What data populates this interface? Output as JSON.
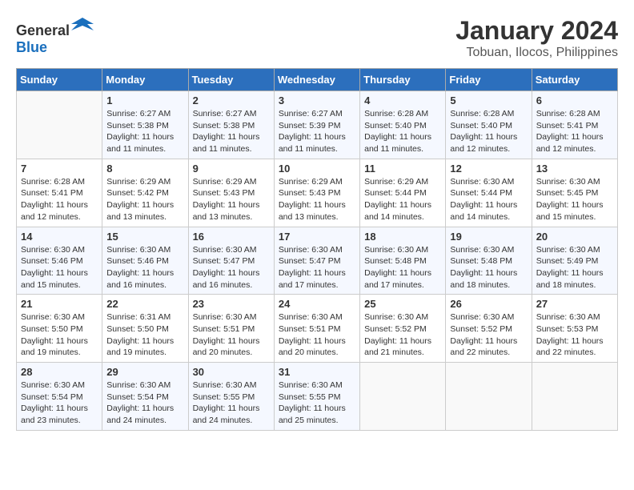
{
  "logo": {
    "general": "General",
    "blue": "Blue"
  },
  "title": "January 2024",
  "subtitle": "Tobuan, Ilocos, Philippines",
  "days_of_week": [
    "Sunday",
    "Monday",
    "Tuesday",
    "Wednesday",
    "Thursday",
    "Friday",
    "Saturday"
  ],
  "weeks": [
    [
      {
        "day": "",
        "sunrise": "",
        "sunset": "",
        "daylight": ""
      },
      {
        "day": "1",
        "sunrise": "Sunrise: 6:27 AM",
        "sunset": "Sunset: 5:38 PM",
        "daylight": "Daylight: 11 hours and 11 minutes."
      },
      {
        "day": "2",
        "sunrise": "Sunrise: 6:27 AM",
        "sunset": "Sunset: 5:38 PM",
        "daylight": "Daylight: 11 hours and 11 minutes."
      },
      {
        "day": "3",
        "sunrise": "Sunrise: 6:27 AM",
        "sunset": "Sunset: 5:39 PM",
        "daylight": "Daylight: 11 hours and 11 minutes."
      },
      {
        "day": "4",
        "sunrise": "Sunrise: 6:28 AM",
        "sunset": "Sunset: 5:40 PM",
        "daylight": "Daylight: 11 hours and 11 minutes."
      },
      {
        "day": "5",
        "sunrise": "Sunrise: 6:28 AM",
        "sunset": "Sunset: 5:40 PM",
        "daylight": "Daylight: 11 hours and 12 minutes."
      },
      {
        "day": "6",
        "sunrise": "Sunrise: 6:28 AM",
        "sunset": "Sunset: 5:41 PM",
        "daylight": "Daylight: 11 hours and 12 minutes."
      }
    ],
    [
      {
        "day": "7",
        "sunrise": "Sunrise: 6:28 AM",
        "sunset": "Sunset: 5:41 PM",
        "daylight": "Daylight: 11 hours and 12 minutes."
      },
      {
        "day": "8",
        "sunrise": "Sunrise: 6:29 AM",
        "sunset": "Sunset: 5:42 PM",
        "daylight": "Daylight: 11 hours and 13 minutes."
      },
      {
        "day": "9",
        "sunrise": "Sunrise: 6:29 AM",
        "sunset": "Sunset: 5:43 PM",
        "daylight": "Daylight: 11 hours and 13 minutes."
      },
      {
        "day": "10",
        "sunrise": "Sunrise: 6:29 AM",
        "sunset": "Sunset: 5:43 PM",
        "daylight": "Daylight: 11 hours and 13 minutes."
      },
      {
        "day": "11",
        "sunrise": "Sunrise: 6:29 AM",
        "sunset": "Sunset: 5:44 PM",
        "daylight": "Daylight: 11 hours and 14 minutes."
      },
      {
        "day": "12",
        "sunrise": "Sunrise: 6:30 AM",
        "sunset": "Sunset: 5:44 PM",
        "daylight": "Daylight: 11 hours and 14 minutes."
      },
      {
        "day": "13",
        "sunrise": "Sunrise: 6:30 AM",
        "sunset": "Sunset: 5:45 PM",
        "daylight": "Daylight: 11 hours and 15 minutes."
      }
    ],
    [
      {
        "day": "14",
        "sunrise": "Sunrise: 6:30 AM",
        "sunset": "Sunset: 5:46 PM",
        "daylight": "Daylight: 11 hours and 15 minutes."
      },
      {
        "day": "15",
        "sunrise": "Sunrise: 6:30 AM",
        "sunset": "Sunset: 5:46 PM",
        "daylight": "Daylight: 11 hours and 16 minutes."
      },
      {
        "day": "16",
        "sunrise": "Sunrise: 6:30 AM",
        "sunset": "Sunset: 5:47 PM",
        "daylight": "Daylight: 11 hours and 16 minutes."
      },
      {
        "day": "17",
        "sunrise": "Sunrise: 6:30 AM",
        "sunset": "Sunset: 5:47 PM",
        "daylight": "Daylight: 11 hours and 17 minutes."
      },
      {
        "day": "18",
        "sunrise": "Sunrise: 6:30 AM",
        "sunset": "Sunset: 5:48 PM",
        "daylight": "Daylight: 11 hours and 17 minutes."
      },
      {
        "day": "19",
        "sunrise": "Sunrise: 6:30 AM",
        "sunset": "Sunset: 5:48 PM",
        "daylight": "Daylight: 11 hours and 18 minutes."
      },
      {
        "day": "20",
        "sunrise": "Sunrise: 6:30 AM",
        "sunset": "Sunset: 5:49 PM",
        "daylight": "Daylight: 11 hours and 18 minutes."
      }
    ],
    [
      {
        "day": "21",
        "sunrise": "Sunrise: 6:30 AM",
        "sunset": "Sunset: 5:50 PM",
        "daylight": "Daylight: 11 hours and 19 minutes."
      },
      {
        "day": "22",
        "sunrise": "Sunrise: 6:31 AM",
        "sunset": "Sunset: 5:50 PM",
        "daylight": "Daylight: 11 hours and 19 minutes."
      },
      {
        "day": "23",
        "sunrise": "Sunrise: 6:30 AM",
        "sunset": "Sunset: 5:51 PM",
        "daylight": "Daylight: 11 hours and 20 minutes."
      },
      {
        "day": "24",
        "sunrise": "Sunrise: 6:30 AM",
        "sunset": "Sunset: 5:51 PM",
        "daylight": "Daylight: 11 hours and 20 minutes."
      },
      {
        "day": "25",
        "sunrise": "Sunrise: 6:30 AM",
        "sunset": "Sunset: 5:52 PM",
        "daylight": "Daylight: 11 hours and 21 minutes."
      },
      {
        "day": "26",
        "sunrise": "Sunrise: 6:30 AM",
        "sunset": "Sunset: 5:52 PM",
        "daylight": "Daylight: 11 hours and 22 minutes."
      },
      {
        "day": "27",
        "sunrise": "Sunrise: 6:30 AM",
        "sunset": "Sunset: 5:53 PM",
        "daylight": "Daylight: 11 hours and 22 minutes."
      }
    ],
    [
      {
        "day": "28",
        "sunrise": "Sunrise: 6:30 AM",
        "sunset": "Sunset: 5:54 PM",
        "daylight": "Daylight: 11 hours and 23 minutes."
      },
      {
        "day": "29",
        "sunrise": "Sunrise: 6:30 AM",
        "sunset": "Sunset: 5:54 PM",
        "daylight": "Daylight: 11 hours and 24 minutes."
      },
      {
        "day": "30",
        "sunrise": "Sunrise: 6:30 AM",
        "sunset": "Sunset: 5:55 PM",
        "daylight": "Daylight: 11 hours and 24 minutes."
      },
      {
        "day": "31",
        "sunrise": "Sunrise: 6:30 AM",
        "sunset": "Sunset: 5:55 PM",
        "daylight": "Daylight: 11 hours and 25 minutes."
      },
      {
        "day": "",
        "sunrise": "",
        "sunset": "",
        "daylight": ""
      },
      {
        "day": "",
        "sunrise": "",
        "sunset": "",
        "daylight": ""
      },
      {
        "day": "",
        "sunrise": "",
        "sunset": "",
        "daylight": ""
      }
    ]
  ]
}
